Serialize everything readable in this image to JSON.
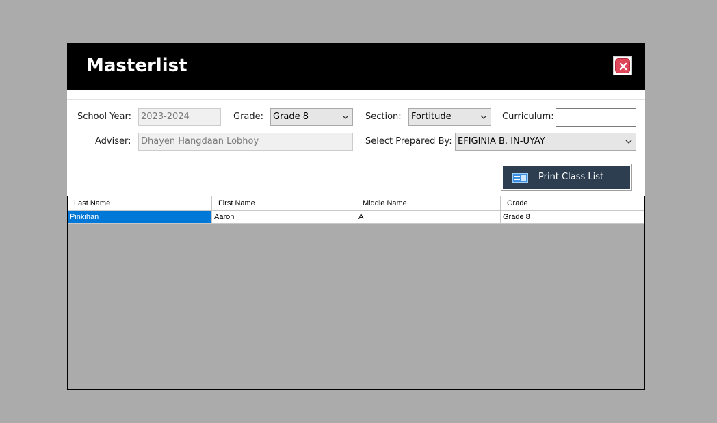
{
  "window": {
    "title": "Masterlist"
  },
  "form": {
    "school_year_label": "School Year:",
    "school_year_value": "2023-2024",
    "grade_label": "Grade:",
    "grade_value": "Grade 8",
    "section_label": "Section:",
    "section_value": "Fortitude",
    "curriculum_label": "Curriculum:",
    "curriculum_value": "",
    "adviser_label": "Adviser:",
    "adviser_value": "Dhayen Hangdaan Lobhoy",
    "prepared_by_label": "Select Prepared By:",
    "prepared_by_value": "EFIGINIA B. IN-UYAY"
  },
  "toolbar": {
    "print_label": "Print Class List",
    "print_icon": "id-card-icon"
  },
  "table": {
    "columns": [
      "Last Name",
      "First Name",
      "Middle Name",
      "Grade"
    ],
    "rows": [
      {
        "last_name": "Pinkihan",
        "first_name": "Aaron",
        "middle_name": "A",
        "grade": "Grade 8"
      }
    ],
    "selected_color": "#0078d7"
  },
  "colors": {
    "titlebar": "#000000",
    "button_bg": "#2c3e50",
    "close_red": "#e0465a"
  }
}
